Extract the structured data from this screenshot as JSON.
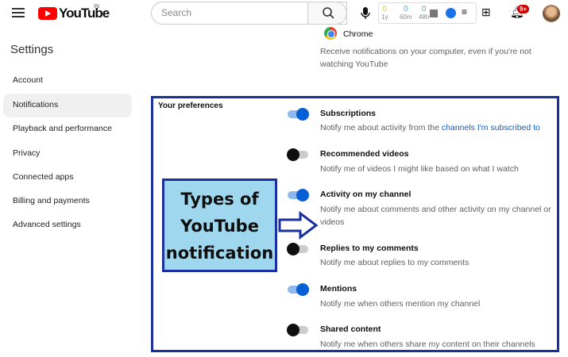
{
  "header": {
    "logo_text": "YouTube",
    "country": "IN",
    "search_placeholder": "Search",
    "stats": [
      {
        "value": "0",
        "label": "1y"
      },
      {
        "value": "0",
        "label": "60m"
      },
      {
        "value": "0",
        "label": "48h"
      }
    ],
    "notification_count": "9+"
  },
  "sidebar": {
    "title": "Settings",
    "items": [
      {
        "label": "Account"
      },
      {
        "label": "Notifications",
        "active": true
      },
      {
        "label": "Playback and performance"
      },
      {
        "label": "Privacy"
      },
      {
        "label": "Connected apps"
      },
      {
        "label": "Billing and payments"
      },
      {
        "label": "Advanced settings"
      }
    ]
  },
  "chrome": {
    "title": "Chrome",
    "description": "Receive notifications on your computer, even if you're not watching YouTube"
  },
  "preferences": {
    "heading": "Your preferences",
    "items": [
      {
        "title": "Subscriptions",
        "desc": "Notify me about activity from the ",
        "link": "channels I'm subscribed to",
        "on": true
      },
      {
        "title": "Recommended videos",
        "desc": "Notify me of videos I might like based on what I watch",
        "on": false
      },
      {
        "title": "Activity on my channel",
        "desc": "Notify me about comments and other activity on my channel or videos",
        "on": true
      },
      {
        "title": "Replies to my comments",
        "desc": "Notify me about replies to my comments",
        "on": false
      },
      {
        "title": "Mentions",
        "desc": "Notify me when others mention my channel",
        "on": true
      },
      {
        "title": "Shared content",
        "desc": "Notify me when others share my content on their channels",
        "on": false
      }
    ]
  },
  "callout": {
    "line1": "Types of",
    "line2": "YouTube",
    "line3": "notification"
  }
}
